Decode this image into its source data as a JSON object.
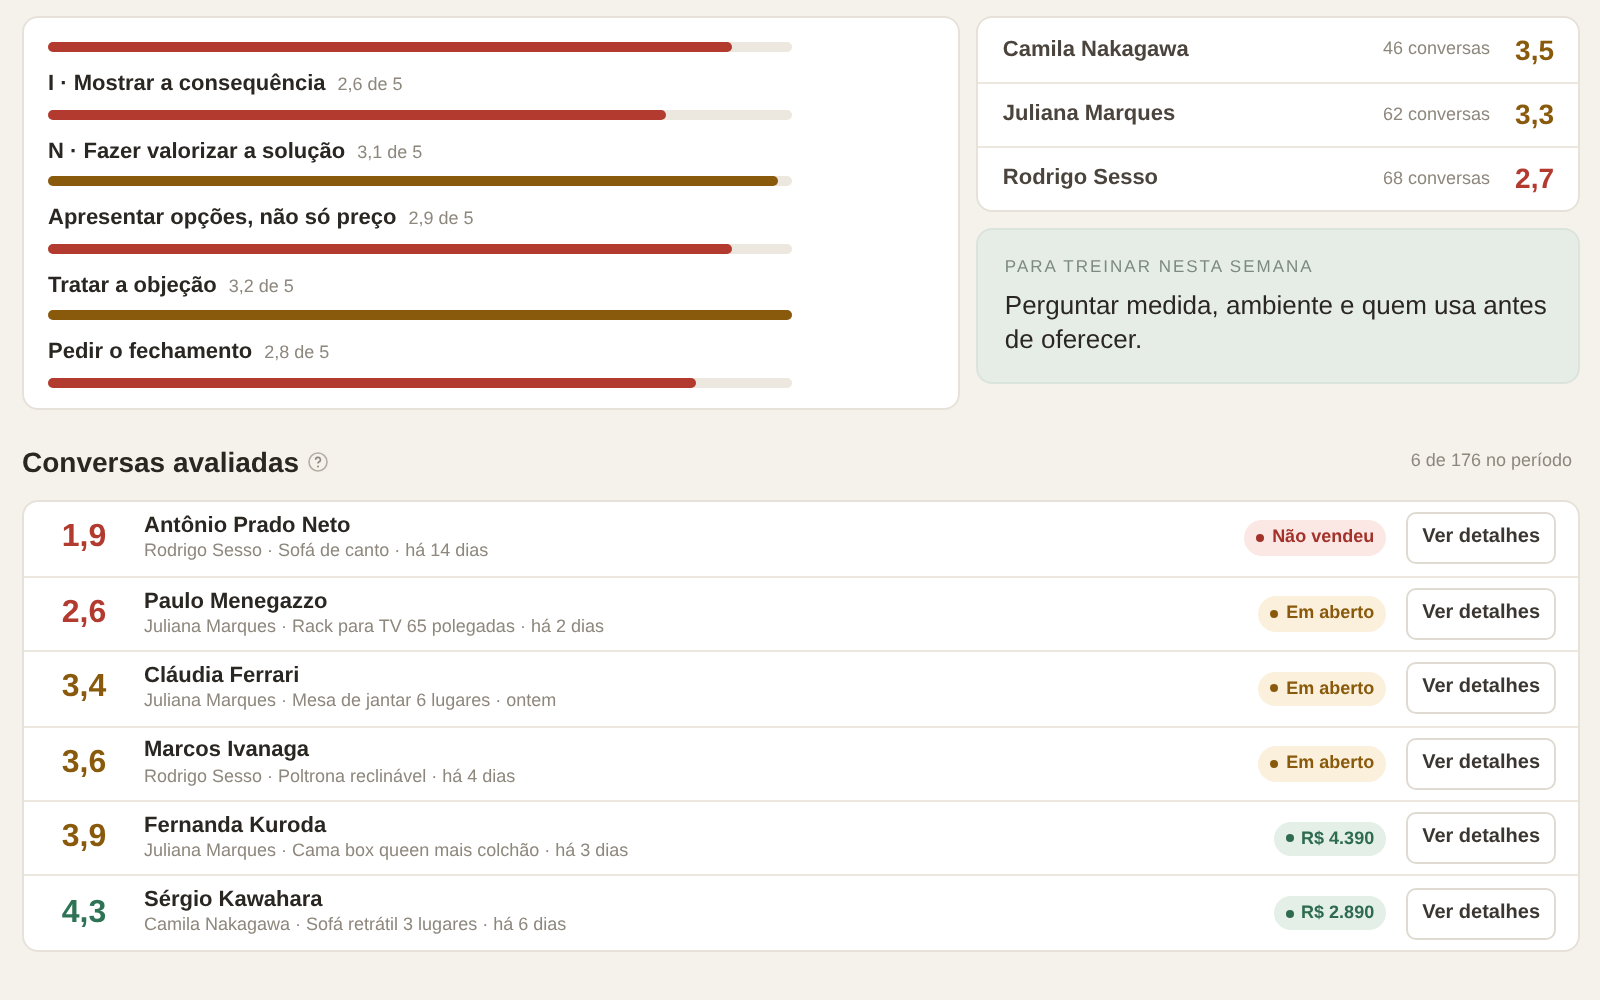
{
  "skills": [
    {
      "level": 0.92,
      "color": "#b23a2e"
    },
    {
      "label": "I · Mostrar a consequência",
      "score": "2,6 de 5",
      "level": 0.83,
      "color": "#b23a2e"
    },
    {
      "label": "N · Fazer valorizar a solução",
      "score": "3,1 de 5",
      "level": 0.98,
      "color": "#8a5a0c"
    },
    {
      "label": "Apresentar opções, não só preço",
      "score": "2,9 de 5",
      "level": 0.92,
      "color": "#b23a2e"
    },
    {
      "label": "Tratar a objeção",
      "score": "3,2 de 5",
      "level": 1.0,
      "color": "#8a5a0c"
    },
    {
      "label": "Pedir o fechamento",
      "score": "2,8 de 5",
      "level": 0.87,
      "color": "#b23a2e"
    }
  ],
  "sellers": [
    {
      "name": "Camila Nakagawa",
      "count": "46 conversas",
      "score": "3,5",
      "color": "#8a5a0c"
    },
    {
      "name": "Juliana Marques",
      "count": "62 conversas",
      "score": "3,3",
      "color": "#8a5a0c"
    },
    {
      "name": "Rodrigo Sesso",
      "count": "68 conversas",
      "score": "2,7",
      "color": "#b23a2e"
    }
  ],
  "training": {
    "eyebrow": "PARA TREINAR NESTA SEMANA",
    "text": "Perguntar medida, ambiente e quem usa antes de oferecer."
  },
  "conversations": {
    "title": "Conversas avaliadas",
    "summary": "6 de 176 no período",
    "rows": [
      {
        "score": "1,9",
        "color": "#b23a2e",
        "customer": "Antônio Prado Neto",
        "meta": "Rodrigo Sesso · Sofá de canto · há 14 dias",
        "status": {
          "kind": "lost",
          "text": "Não vendeu"
        },
        "action": "Ver detalhes"
      },
      {
        "score": "2,6",
        "color": "#b23a2e",
        "customer": "Paulo Menegazzo",
        "meta": "Juliana Marques · Rack para TV 65 polegadas · há 2 dias",
        "status": {
          "kind": "open",
          "text": "Em aberto"
        },
        "action": "Ver detalhes"
      },
      {
        "score": "3,4",
        "color": "#8a5a0c",
        "customer": "Cláudia Ferrari",
        "meta": "Juliana Marques · Mesa de jantar 6 lugares · ontem",
        "status": {
          "kind": "open",
          "text": "Em aberto"
        },
        "action": "Ver detalhes"
      },
      {
        "score": "3,6",
        "color": "#8a5a0c",
        "customer": "Marcos Ivanaga",
        "meta": "Rodrigo Sesso · Poltrona reclinável · há 4 dias",
        "status": {
          "kind": "open",
          "text": "Em aberto"
        },
        "action": "Ver detalhes"
      },
      {
        "score": "3,9",
        "color": "#8a5a0c",
        "customer": "Fernanda Kuroda",
        "meta": "Juliana Marques · Cama box queen mais colchão · há 3 dias",
        "status": {
          "kind": "sold",
          "text": "R$ 4.390"
        },
        "action": "Ver detalhes"
      },
      {
        "score": "4,3",
        "color": "#2e7355",
        "customer": "Sérgio Kawahara",
        "meta": "Camila Nakagawa · Sofá retrátil 3 lugares · há 6 dias",
        "status": {
          "kind": "sold",
          "text": "R$ 2.890"
        },
        "action": "Ver detalhes"
      }
    ]
  }
}
